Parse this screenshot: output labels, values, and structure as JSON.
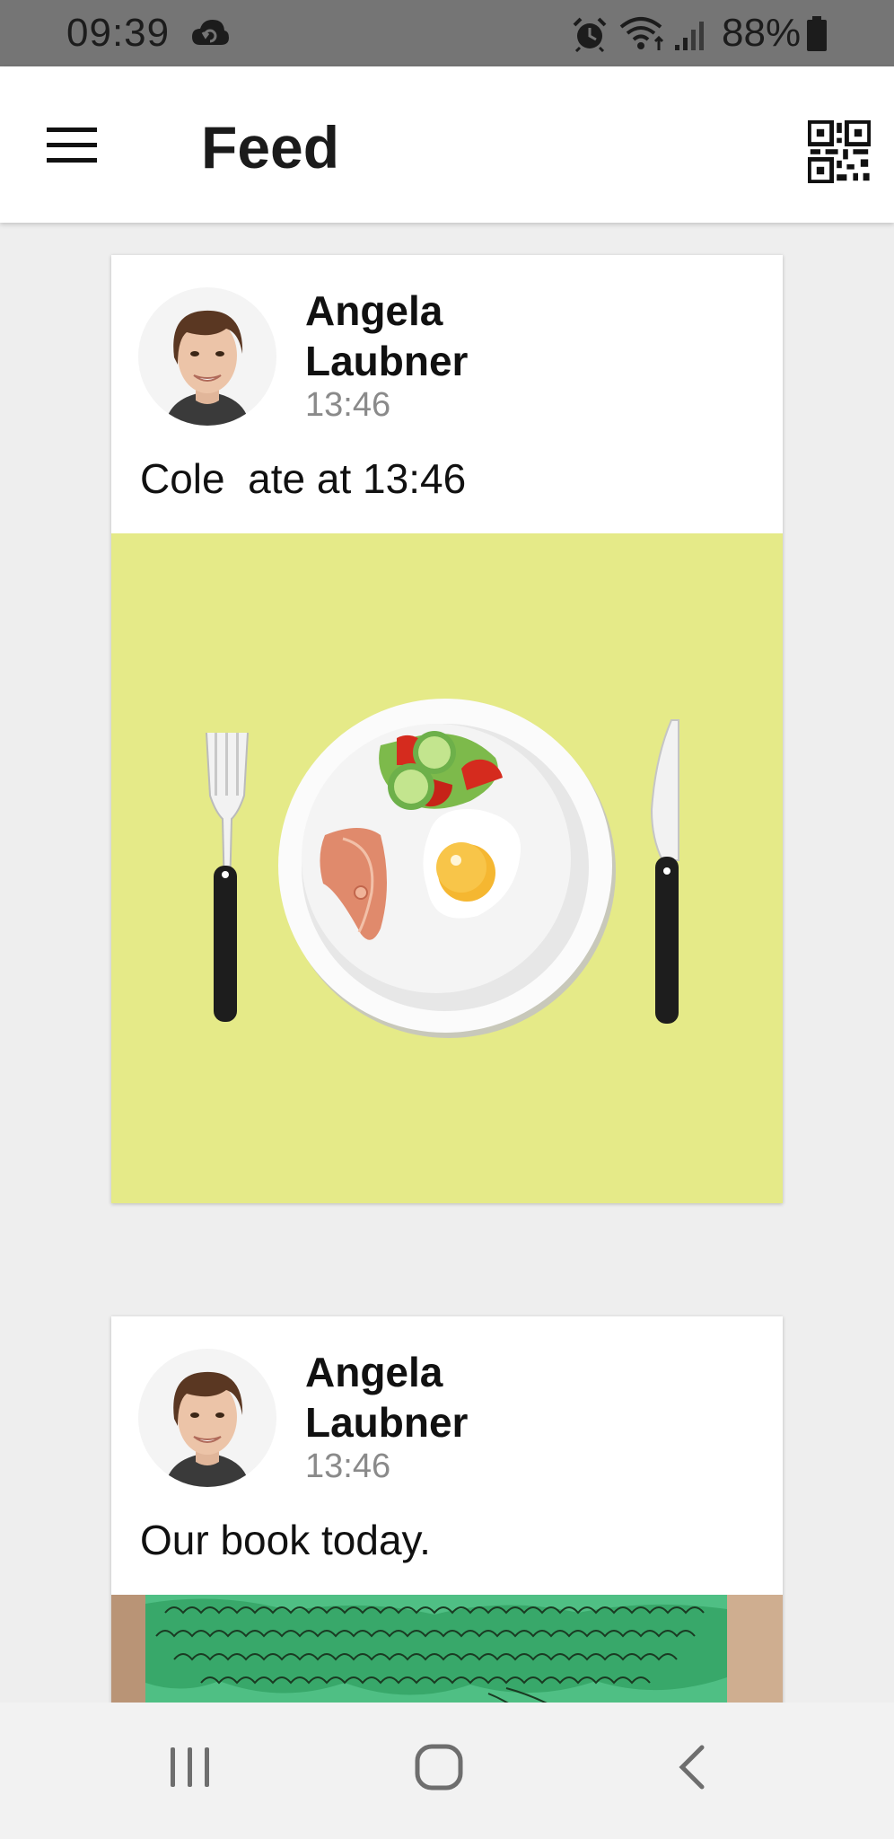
{
  "status_bar": {
    "time": "09:39",
    "battery_percent": "88%",
    "icons": [
      "cloud-sync-icon",
      "alarm-icon",
      "wifi-icon",
      "signal-icon",
      "battery-icon"
    ]
  },
  "app_bar": {
    "title": "Feed",
    "left_icon": "menu-icon",
    "right_icon": "qr-code-icon"
  },
  "feed": {
    "posts": [
      {
        "author": "Angela Laubner",
        "time": "13:46",
        "text": "Cole  ate at 13:46",
        "image": "meal-plate-illustration"
      },
      {
        "author": "Angela Laubner",
        "time": "13:46",
        "text": "Our book today.",
        "image": "book-cover-photo"
      }
    ]
  },
  "nav_bar": {
    "icons": [
      "recents-icon",
      "home-icon",
      "back-icon"
    ]
  },
  "colors": {
    "status_bar_bg": "#757575",
    "app_bar_bg": "#ffffff",
    "feed_bg": "#eeeeee",
    "meal_image_bg": "#e5ea88",
    "time_text": "#8a8a8a"
  }
}
